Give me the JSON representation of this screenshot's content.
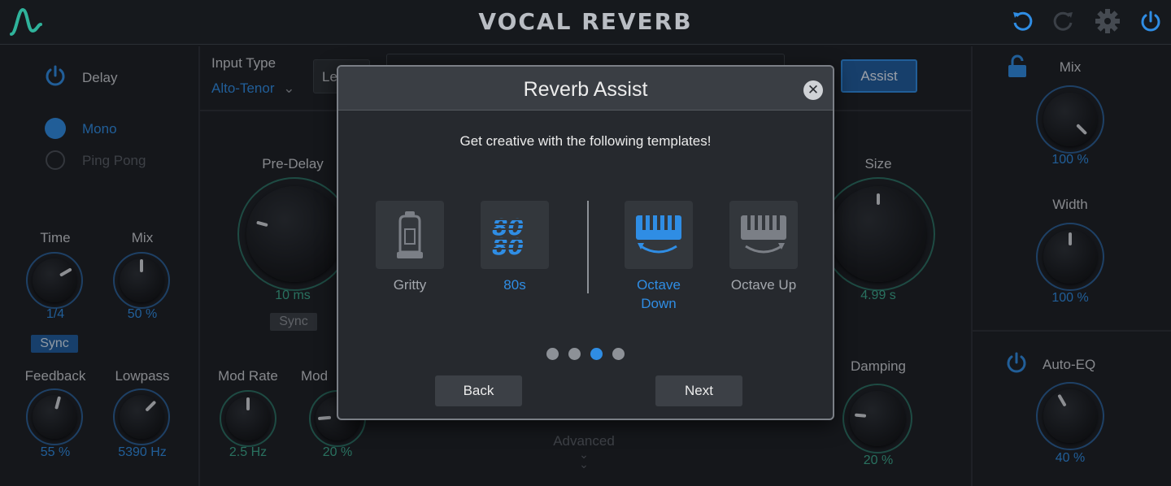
{
  "app": {
    "title": "VOCAL REVERB"
  },
  "colors": {
    "accent": "#2f8de4",
    "teal": "#3ba98d",
    "bg": "#1c1f24"
  },
  "header": {
    "icons": [
      "logo-icon",
      "undo-icon",
      "redo-icon",
      "settings-icon",
      "power-icon"
    ]
  },
  "left": {
    "delay_label": "Delay",
    "mode_mono": "Mono",
    "mode_pingpong": "Ping Pong",
    "time": {
      "label": "Time",
      "value": "1/4"
    },
    "mix": {
      "label": "Mix",
      "value": "50 %"
    },
    "sync_label": "Sync",
    "feedback": {
      "label": "Feedback",
      "value": "55 %"
    },
    "lowpass": {
      "label": "Lowpass",
      "value": "5390 Hz"
    }
  },
  "center": {
    "input_type_label": "Input Type",
    "input_type_value": "Alto-Tenor",
    "level_button_partial": "Le",
    "assist_button": "Assist",
    "predelay": {
      "label": "Pre-Delay",
      "value": "10 ms"
    },
    "predelay_sync": "Sync",
    "modrate": {
      "label": "Mod Rate",
      "value": "2.5 Hz"
    },
    "moddepth": {
      "label": "Mod",
      "value": "20 %"
    },
    "size": {
      "label": "Size",
      "value": "4.99 s"
    },
    "damping": {
      "label": "Damping",
      "value": "20 %"
    },
    "advanced_label": "Advanced"
  },
  "right": {
    "mix": {
      "label": "Mix",
      "value": "100 %"
    },
    "width": {
      "label": "Width",
      "value": "100 %"
    },
    "autoeq": {
      "label": "Auto-EQ",
      "value": "40 %"
    }
  },
  "modal": {
    "title": "Reverb Assist",
    "subtitle": "Get creative with the following templates!",
    "templates": [
      {
        "name": "Gritty",
        "icon": "tube-icon",
        "active": false
      },
      {
        "name": "80s",
        "icon": "eighties-icon",
        "active": true
      },
      {
        "name": "Octave Down",
        "icon": "keyboard-down-icon",
        "active": true
      },
      {
        "name": "Octave Up",
        "icon": "keyboard-up-icon",
        "active": false
      }
    ],
    "page_current": 3,
    "page_total": 4,
    "back_label": "Back",
    "next_label": "Next"
  }
}
